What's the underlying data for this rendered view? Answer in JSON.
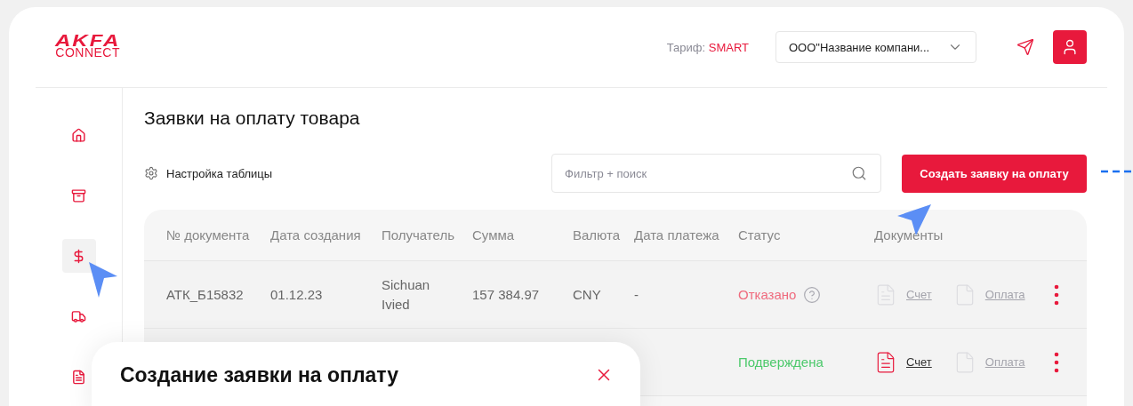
{
  "logo": {
    "top": "AKFA",
    "bottom": "CONNECT"
  },
  "header": {
    "tariff_label": "Тариф:",
    "tariff_value": "SMART",
    "company": "ООО\"Название компани..."
  },
  "sidebar": {
    "items": [
      {
        "kind": "home",
        "selected": false
      },
      {
        "kind": "archive",
        "selected": false
      },
      {
        "kind": "dollar",
        "selected": true
      },
      {
        "kind": "truck",
        "selected": false
      },
      {
        "kind": "document",
        "selected": false
      }
    ]
  },
  "page_title": "Заявки на оплату товара",
  "table_settings": "Настройка таблицы",
  "search": {
    "placeholder": "Фильтр + поиск"
  },
  "create_button": "Создать заявку на оплату",
  "table": {
    "columns": [
      "№ документа",
      "Дата создания",
      "Получатель",
      "Сумма",
      "Валюта",
      "Дата платежа",
      "Статус",
      "Документы"
    ],
    "rows": [
      {
        "cells": [
          "АТК_Б15832",
          "01.12.23",
          "Sichuan Ivied",
          "157 384.97",
          "CNY",
          "-"
        ],
        "status": {
          "text": "Отказано",
          "kind": "rejected",
          "help": true
        },
        "docs": [
          {
            "label": "Счет",
            "disabled": true,
            "kind": "lined"
          },
          {
            "label": "Оплата",
            "disabled": true,
            "kind": "blank"
          }
        ]
      },
      {
        "cells": [],
        "status": {
          "text": "Подверждена",
          "kind": "approved",
          "help": false
        },
        "docs": [
          {
            "label": "Счет",
            "disabled": false,
            "kind": "lined"
          },
          {
            "label": "Оплата",
            "disabled": true,
            "kind": "blank"
          }
        ]
      }
    ]
  },
  "modal": {
    "title": "Создание заявки на оплату"
  }
}
